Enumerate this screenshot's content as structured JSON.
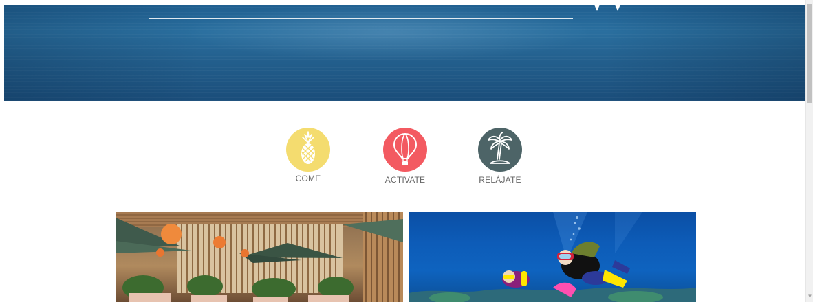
{
  "hero": {
    "description_colors": {
      "water_top": "#1f5f90",
      "water_bottom": "#1a4d7a"
    }
  },
  "categories": [
    {
      "label": "COME",
      "icon": "pineapple-icon",
      "color": "#f4dc6f"
    },
    {
      "label": "ACTIVATE",
      "icon": "hot-air-balloon-icon",
      "color": "#f35a61"
    },
    {
      "label": "RELÁJATE",
      "icon": "palm-tree-icon",
      "color": "#4d6467"
    }
  ],
  "photos": [
    {
      "subject": "restaurant-photo"
    },
    {
      "subject": "scuba-diving-photo"
    }
  ]
}
